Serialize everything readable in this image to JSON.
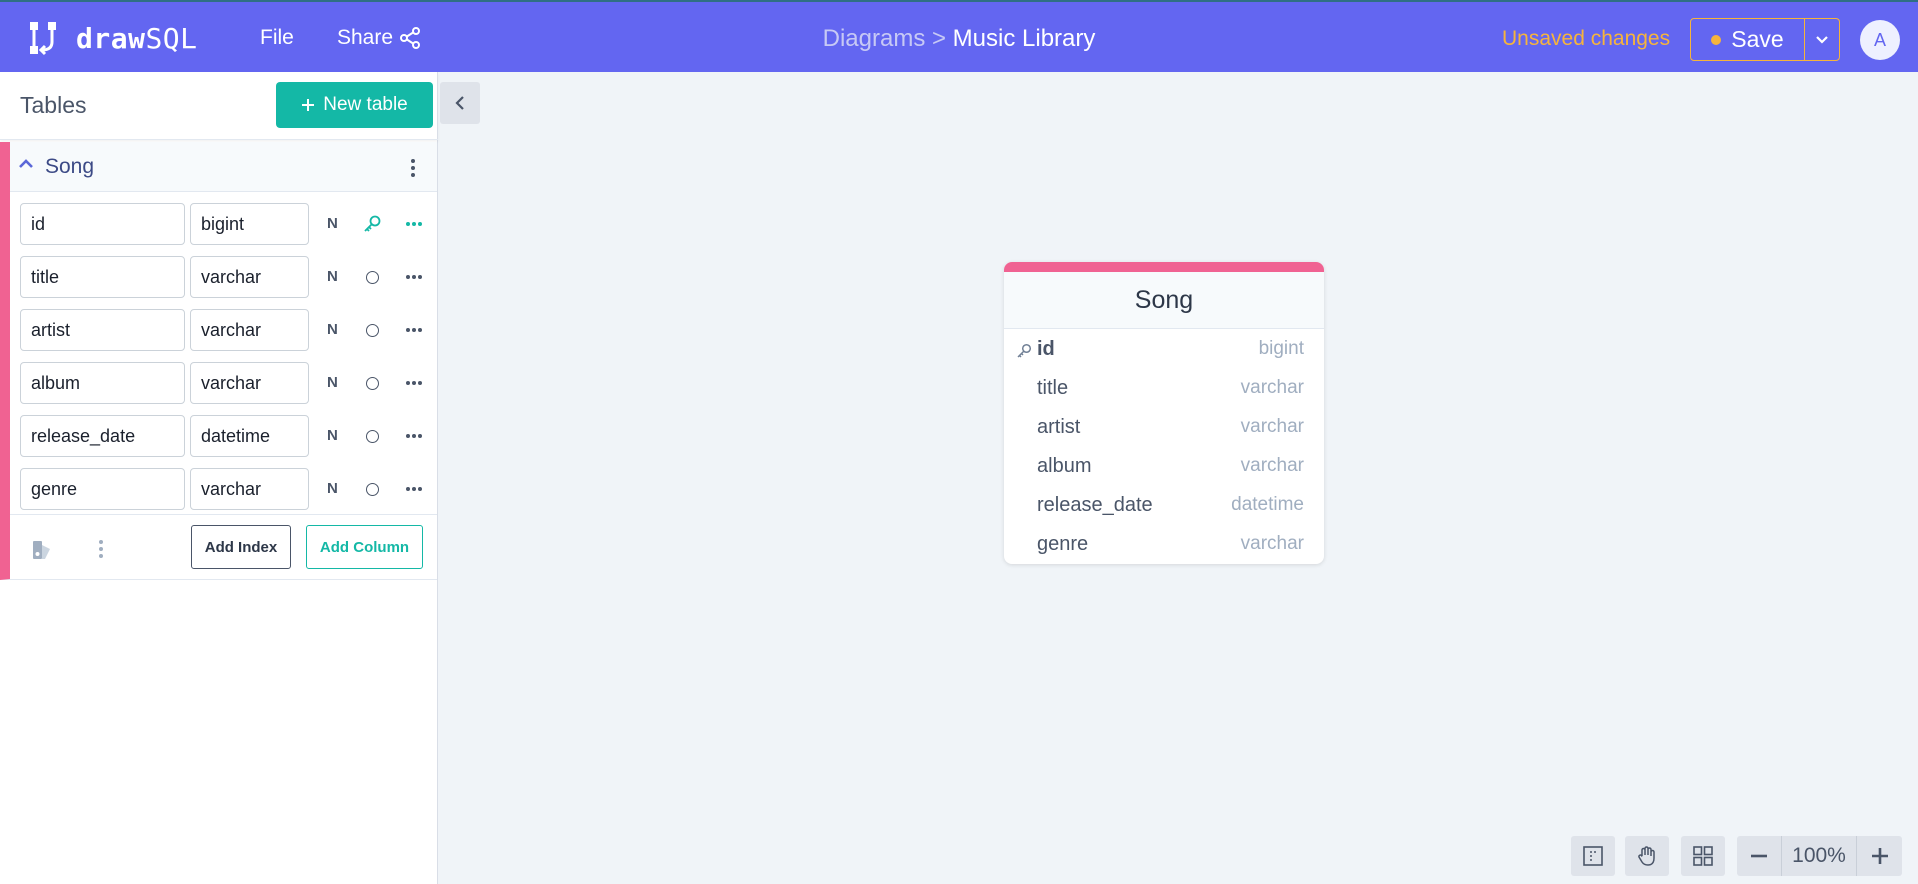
{
  "app": {
    "logo_bold": "draw",
    "logo_light": "SQL"
  },
  "menu": {
    "file": "File",
    "share": "Share"
  },
  "breadcrumb": {
    "parent": "Diagrams >",
    "current": "Music Library"
  },
  "status": {
    "unsaved": "Unsaved changes"
  },
  "actions": {
    "save": "Save",
    "avatar_initial": "A"
  },
  "sidebar": {
    "title": "Tables",
    "new_table": "New table",
    "table": {
      "name": "Song",
      "columns": [
        {
          "name": "id",
          "type": "bigint",
          "nullable": "N",
          "primary_key": true
        },
        {
          "name": "title",
          "type": "varchar",
          "nullable": "N",
          "primary_key": false
        },
        {
          "name": "artist",
          "type": "varchar",
          "nullable": "N",
          "primary_key": false
        },
        {
          "name": "album",
          "type": "varchar",
          "nullable": "N",
          "primary_key": false
        },
        {
          "name": "release_date",
          "type": "datetime",
          "nullable": "N",
          "primary_key": false
        },
        {
          "name": "genre",
          "type": "varchar",
          "nullable": "N",
          "primary_key": false
        }
      ],
      "add_index": "Add Index",
      "add_column": "Add Column"
    }
  },
  "canvas": {
    "card": {
      "title": "Song",
      "rows": [
        {
          "name": "id",
          "type": "bigint",
          "pk": true
        },
        {
          "name": "title",
          "type": "varchar",
          "pk": false
        },
        {
          "name": "artist",
          "type": "varchar",
          "pk": false
        },
        {
          "name": "album",
          "type": "varchar",
          "pk": false
        },
        {
          "name": "release_date",
          "type": "datetime",
          "pk": false
        },
        {
          "name": "genre",
          "type": "varchar",
          "pk": false
        }
      ]
    },
    "zoom": "100%"
  },
  "colors": {
    "header_bg": "#6366f1",
    "accent_teal": "#14b8a6",
    "warning": "#f6b43c",
    "table_color": "#f06292"
  }
}
